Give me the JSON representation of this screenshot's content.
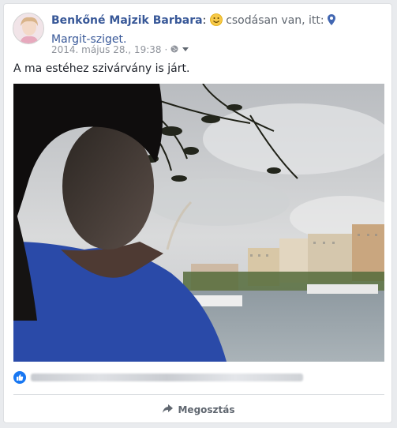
{
  "post": {
    "author": "Benkőné Majzik Barbara",
    "colon": ":",
    "feeling": "csodásan van, itt:",
    "place": "Margit-sziget.",
    "timestamp": "2014. május 28., 19:38",
    "separator": "·",
    "text": "A ma estéhez szivárvány is járt."
  },
  "actions": {
    "share_label": "Megosztás"
  },
  "colors": {
    "link": "#385898",
    "like": "#1877f2",
    "muted": "#90949c"
  },
  "icons": [
    "smiley-emoji-icon",
    "location-pin-icon",
    "globe-icon",
    "caret-down-icon",
    "like-icon",
    "share-arrow-icon"
  ]
}
